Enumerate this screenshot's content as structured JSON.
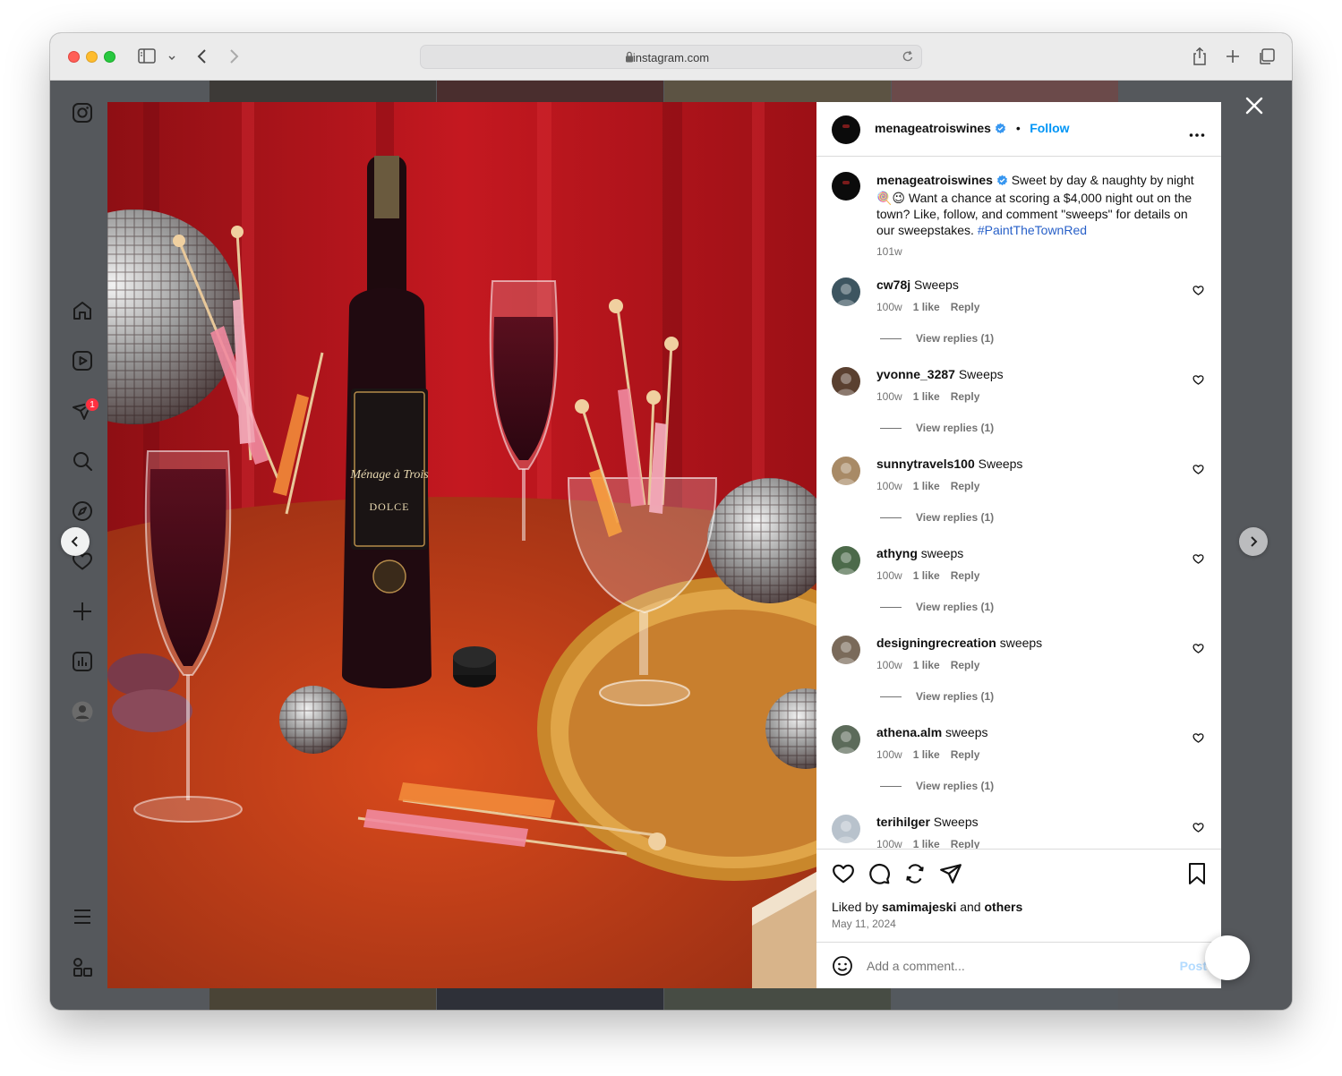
{
  "browser": {
    "url": "instagram.com"
  },
  "post": {
    "author": "menageatroiswines",
    "follow_label": "Follow",
    "separator": "•",
    "caption": {
      "user": "menageatroiswines",
      "text": "Sweet by day & naughty by night 🍭😉 Want a chance at scoring a $4,000 night out on the town? Like, follow, and comment \"sweeps\" for details on our sweepstakes.",
      "hashtag": "#PaintTheTownRed",
      "age": "101w"
    },
    "comments": [
      {
        "user": "cw78j",
        "text": "Sweeps",
        "age": "100w",
        "likes": "1 like",
        "reply": "Reply",
        "replies": "View replies (1)",
        "avatar_color": "#3d5560"
      },
      {
        "user": "yvonne_3287",
        "text": "Sweeps",
        "age": "100w",
        "likes": "1 like",
        "reply": "Reply",
        "replies": "View replies (1)",
        "avatar_color": "#5a4030"
      },
      {
        "user": "sunnytravels100",
        "text": "Sweeps",
        "age": "100w",
        "likes": "1 like",
        "reply": "Reply",
        "replies": "View replies (1)",
        "avatar_color": "#a88a66"
      },
      {
        "user": "athyng",
        "text": "sweeps",
        "age": "100w",
        "likes": "1 like",
        "reply": "Reply",
        "replies": "View replies (1)",
        "avatar_color": "#4c6a4a"
      },
      {
        "user": "designingrecreation",
        "text": "sweeps",
        "age": "100w",
        "likes": "1 like",
        "reply": "Reply",
        "replies": "View replies (1)",
        "avatar_color": "#7a6a5a"
      },
      {
        "user": "athena.alm",
        "text": "sweeps",
        "age": "100w",
        "likes": "1 like",
        "reply": "Reply",
        "replies": "View replies (1)",
        "avatar_color": "#5c6b5a"
      },
      {
        "user": "terihilger",
        "text": "Sweeps",
        "age": "100w",
        "likes": "1 like",
        "reply": "Reply",
        "replies": "",
        "avatar_color": "#b8c2cc"
      }
    ],
    "liked_by_prefix": "Liked by",
    "liked_by_user": "samimajeski",
    "liked_by_and": "and",
    "liked_by_others": "others",
    "date": "May 11, 2024",
    "add_comment_placeholder": "Add a comment...",
    "post_label": "Post"
  },
  "sidebar": {
    "notification_count": "1"
  },
  "colors": {
    "accent": "#0095f6",
    "hashtag": "#2860c8",
    "overlay": "#55585c"
  }
}
